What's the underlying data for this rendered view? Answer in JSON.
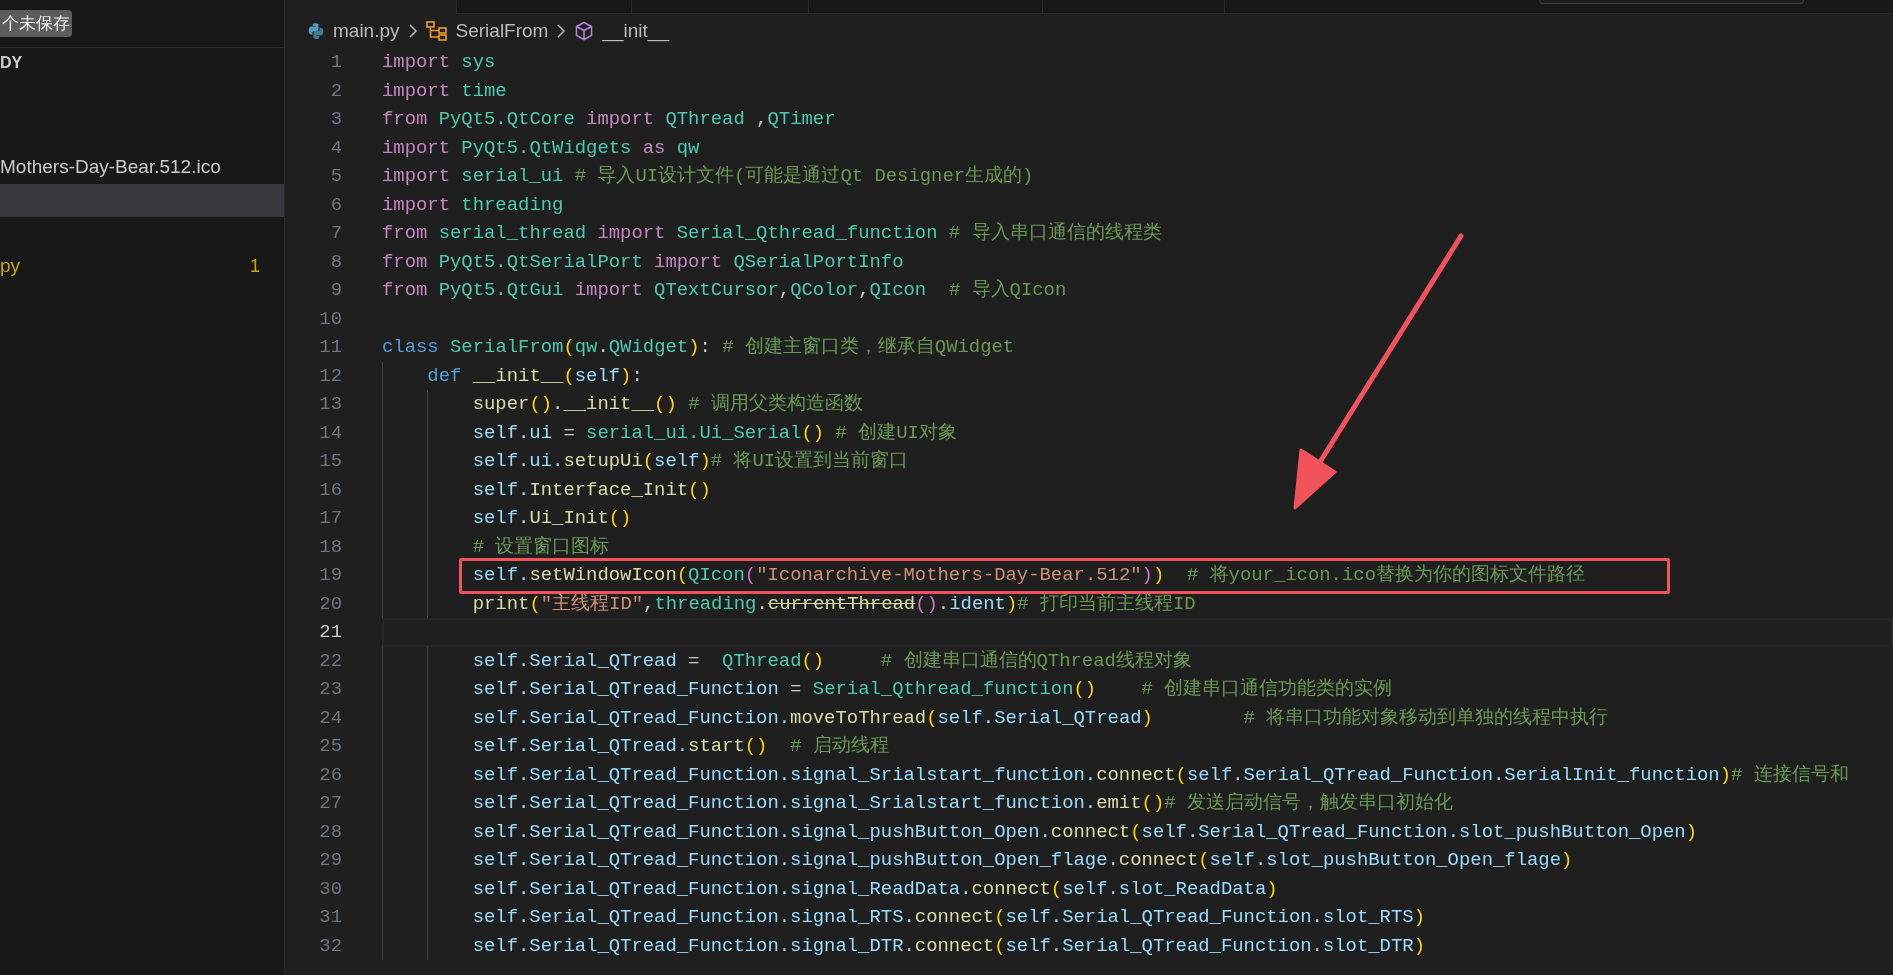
{
  "sidebar": {
    "unsaved_badge": "个未保存",
    "section_heading": "DY",
    "items": [
      {
        "name": "Mothers-Day-Bear.512.ico",
        "selected": false,
        "kind": "file"
      },
      {
        "selected": true,
        "kind": "blank"
      },
      {
        "name": "py",
        "selected": false,
        "kind": "warning",
        "problems": "1"
      }
    ]
  },
  "tabs": [
    {
      "selected": true
    },
    {
      "selected": false
    },
    {
      "selected": false
    },
    {
      "selected": false
    },
    {
      "selected": false
    }
  ],
  "breadcrumb": [
    {
      "kind": "file",
      "text": "main.py"
    },
    {
      "kind": "class",
      "text": "SerialFrom"
    },
    {
      "kind": "method",
      "text": "__init__"
    }
  ],
  "lines": [
    {
      "number": "1",
      "current": false,
      "boxed": false,
      "tokens": [
        {
          "kind": "kw",
          "text": "import "
        },
        {
          "kind": "mod",
          "text": "sys"
        }
      ]
    },
    {
      "number": "2",
      "current": false,
      "boxed": false,
      "tokens": [
        {
          "kind": "kw",
          "text": "import "
        },
        {
          "kind": "mod",
          "text": "time"
        }
      ]
    },
    {
      "number": "3",
      "current": false,
      "boxed": false,
      "tokens": [
        {
          "kind": "kw",
          "text": "from "
        },
        {
          "kind": "mod",
          "text": "PyQt5.QtCore "
        },
        {
          "kind": "kw",
          "text": "import "
        },
        {
          "kind": "mod",
          "text": "QThread"
        },
        {
          "kind": "p",
          "text": " ,"
        },
        {
          "kind": "mod",
          "text": "QTimer"
        }
      ]
    },
    {
      "number": "4",
      "current": false,
      "boxed": false,
      "tokens": [
        {
          "kind": "kw",
          "text": "import "
        },
        {
          "kind": "mod",
          "text": "PyQt5.QtWidgets "
        },
        {
          "kind": "kw",
          "text": "as "
        },
        {
          "kind": "mod",
          "text": "qw"
        }
      ]
    },
    {
      "number": "5",
      "current": false,
      "boxed": false,
      "tokens": [
        {
          "kind": "kw",
          "text": "import "
        },
        {
          "kind": "mod",
          "text": "serial_ui"
        },
        {
          "kind": "cm",
          "text": " # 导入UI设计文件(可能是通过Qt Designer生成的)"
        }
      ]
    },
    {
      "number": "6",
      "current": false,
      "boxed": false,
      "tokens": [
        {
          "kind": "kw",
          "text": "import "
        },
        {
          "kind": "mod",
          "text": "threading"
        }
      ]
    },
    {
      "number": "7",
      "current": false,
      "boxed": false,
      "tokens": [
        {
          "kind": "kw",
          "text": "from "
        },
        {
          "kind": "mod",
          "text": "serial_thread "
        },
        {
          "kind": "kw",
          "text": "import "
        },
        {
          "kind": "mod",
          "text": "Serial_Qthread_function"
        },
        {
          "kind": "cm",
          "text": " # 导入串口通信的线程类"
        }
      ]
    },
    {
      "number": "8",
      "current": false,
      "boxed": false,
      "tokens": [
        {
          "kind": "kw",
          "text": "from "
        },
        {
          "kind": "mod",
          "text": "PyQt5.QtSerialPort "
        },
        {
          "kind": "kw",
          "text": "import "
        },
        {
          "kind": "mod",
          "text": "QSerialPortInfo"
        }
      ]
    },
    {
      "number": "9",
      "current": false,
      "boxed": false,
      "tokens": [
        {
          "kind": "kw",
          "text": "from "
        },
        {
          "kind": "mod",
          "text": "PyQt5.QtGui "
        },
        {
          "kind": "kw",
          "text": "import "
        },
        {
          "kind": "mod",
          "text": "QTextCursor"
        },
        {
          "kind": "p",
          "text": ","
        },
        {
          "kind": "mod",
          "text": "QColor"
        },
        {
          "kind": "p",
          "text": ","
        },
        {
          "kind": "mod",
          "text": "QIcon"
        },
        {
          "kind": "cm",
          "text": "  # 导入QIcon"
        }
      ]
    },
    {
      "number": "10",
      "current": false,
      "boxed": false
    },
    {
      "number": "11",
      "current": false,
      "boxed": false,
      "tokens": [
        {
          "kind": "ctrl",
          "text": "class "
        },
        {
          "kind": "mod",
          "text": "SerialFrom"
        },
        {
          "kind": "b1",
          "text": "("
        },
        {
          "kind": "mod",
          "text": "qw"
        },
        {
          "kind": "p",
          "text": "."
        },
        {
          "kind": "mod",
          "text": "QWidget"
        },
        {
          "kind": "b1",
          "text": ")"
        },
        {
          "kind": "p",
          "text": ":"
        },
        {
          "kind": "cm",
          "text": " # 创建主窗口类，继承自QWidget"
        }
      ]
    },
    {
      "number": "12",
      "current": false,
      "boxed": false,
      "tokens": [
        {
          "kind": "ctrl",
          "text": "    def "
        },
        {
          "kind": "fn",
          "text": "__init__"
        },
        {
          "kind": "b1",
          "text": "("
        },
        {
          "kind": "var",
          "text": "self"
        },
        {
          "kind": "b1",
          "text": ")"
        },
        {
          "kind": "p",
          "text": ":"
        }
      ]
    },
    {
      "number": "13",
      "current": false,
      "boxed": false,
      "tokens": [
        {
          "kind": "fn",
          "text": "        super"
        },
        {
          "kind": "b1",
          "text": "()"
        },
        {
          "kind": "p",
          "text": "."
        },
        {
          "kind": "fn",
          "text": "__init__"
        },
        {
          "kind": "b1",
          "text": "()"
        },
        {
          "kind": "cm",
          "text": " # 调用父类构造函数"
        }
      ]
    },
    {
      "number": "14",
      "current": false,
      "boxed": false,
      "tokens": [
        {
          "kind": "var",
          "text": "        self.ui"
        },
        {
          "kind": "p",
          "text": " = "
        },
        {
          "kind": "mod",
          "text": "serial_ui.Ui_Serial"
        },
        {
          "kind": "b1",
          "text": "()"
        },
        {
          "kind": "cm",
          "text": " # 创建UI对象"
        }
      ]
    },
    {
      "number": "15",
      "current": false,
      "boxed": false,
      "tokens": [
        {
          "kind": "var",
          "text": "        self.ui."
        },
        {
          "kind": "fn",
          "text": "setupUi"
        },
        {
          "kind": "b1",
          "text": "("
        },
        {
          "kind": "var",
          "text": "self"
        },
        {
          "kind": "b1",
          "text": ")"
        },
        {
          "kind": "cm",
          "text": "# 将UI设置到当前窗口"
        }
      ]
    },
    {
      "number": "16",
      "current": false,
      "boxed": false,
      "tokens": [
        {
          "kind": "var",
          "text": "        self."
        },
        {
          "kind": "fn",
          "text": "Interface_Init"
        },
        {
          "kind": "b1",
          "text": "()"
        }
      ]
    },
    {
      "number": "17",
      "current": false,
      "boxed": false,
      "tokens": [
        {
          "kind": "var",
          "text": "        self."
        },
        {
          "kind": "fn",
          "text": "Ui_Init"
        },
        {
          "kind": "b1",
          "text": "()"
        }
      ]
    },
    {
      "number": "18",
      "current": false,
      "boxed": false,
      "tokens": [
        {
          "kind": "cm",
          "text": "        # 设置窗口图标"
        }
      ]
    },
    {
      "number": "19",
      "current": false,
      "boxed": true,
      "tokens": [
        {
          "kind": "var",
          "text": "        self."
        },
        {
          "kind": "fn",
          "text": "setWindowIcon"
        },
        {
          "kind": "b1",
          "text": "("
        },
        {
          "kind": "mod",
          "text": "QIcon"
        },
        {
          "kind": "b2",
          "text": "("
        },
        {
          "kind": "str",
          "text": "\"Iconarchive-Mothers-Day-Bear.512\""
        },
        {
          "kind": "b2",
          "text": ")"
        },
        {
          "kind": "b1",
          "text": ")"
        },
        {
          "kind": "cm",
          "text": "  # 将your_icon.ico替换为你的图标文件路径"
        }
      ]
    },
    {
      "number": "20",
      "current": false,
      "boxed": false,
      "tokens": [
        {
          "kind": "fn",
          "text": "        print"
        },
        {
          "kind": "b1",
          "text": "("
        },
        {
          "kind": "str",
          "text": "\"主线程ID\""
        },
        {
          "kind": "p",
          "text": ","
        },
        {
          "kind": "mod",
          "text": "threading"
        },
        {
          "kind": "p",
          "text": "."
        },
        {
          "kind": "dep",
          "text": "currentThread"
        },
        {
          "kind": "b2",
          "text": "()"
        },
        {
          "kind": "p",
          "text": "."
        },
        {
          "kind": "var",
          "text": "ident"
        },
        {
          "kind": "b1",
          "text": ")"
        },
        {
          "kind": "cm",
          "text": "# 打印当前主线程ID"
        }
      ]
    },
    {
      "number": "21",
      "current": true,
      "boxed": false
    },
    {
      "number": "22",
      "current": false,
      "boxed": false,
      "tokens": [
        {
          "kind": "var",
          "text": "        self.Serial_QTread"
        },
        {
          "kind": "p",
          "text": " =  "
        },
        {
          "kind": "mod",
          "text": "QThread"
        },
        {
          "kind": "b1",
          "text": "()"
        },
        {
          "kind": "cm",
          "text": "     # 创建串口通信的QThread线程对象"
        }
      ]
    },
    {
      "number": "23",
      "current": false,
      "boxed": false,
      "tokens": [
        {
          "kind": "var",
          "text": "        self.Serial_QTread_Function"
        },
        {
          "kind": "p",
          "text": " = "
        },
        {
          "kind": "mod",
          "text": "Serial_Qthread_function"
        },
        {
          "kind": "b1",
          "text": "()"
        },
        {
          "kind": "cm",
          "text": "    # 创建串口通信功能类的实例"
        }
      ]
    },
    {
      "number": "24",
      "current": false,
      "boxed": false,
      "tokens": [
        {
          "kind": "var",
          "text": "        self.Serial_QTread_Function."
        },
        {
          "kind": "fn",
          "text": "moveToThread"
        },
        {
          "kind": "b1",
          "text": "("
        },
        {
          "kind": "var",
          "text": "self.Serial_QTread"
        },
        {
          "kind": "b1",
          "text": ")"
        },
        {
          "kind": "cm",
          "text": "        # 将串口功能对象移动到单独的线程中执行"
        }
      ]
    },
    {
      "number": "25",
      "current": false,
      "boxed": false,
      "tokens": [
        {
          "kind": "var",
          "text": "        self.Serial_QTread."
        },
        {
          "kind": "fn",
          "text": "start"
        },
        {
          "kind": "b1",
          "text": "()"
        },
        {
          "kind": "cm",
          "text": "  # 启动线程"
        }
      ]
    },
    {
      "number": "26",
      "current": false,
      "boxed": false,
      "tokens": [
        {
          "kind": "var",
          "text": "        self.Serial_QTread_Function.signal_Srialstart_function."
        },
        {
          "kind": "fn",
          "text": "connect"
        },
        {
          "kind": "b1",
          "text": "("
        },
        {
          "kind": "var",
          "text": "self.Serial_QTread_Function.SerialInit_function"
        },
        {
          "kind": "b1",
          "text": ")"
        },
        {
          "kind": "cm",
          "text": "# 连接信号和"
        }
      ]
    },
    {
      "number": "27",
      "current": false,
      "boxed": false,
      "tokens": [
        {
          "kind": "var",
          "text": "        self.Serial_QTread_Function.signal_Srialstart_function."
        },
        {
          "kind": "fn",
          "text": "emit"
        },
        {
          "kind": "b1",
          "text": "()"
        },
        {
          "kind": "cm",
          "text": "# 发送启动信号，触发串口初始化"
        }
      ]
    },
    {
      "number": "28",
      "current": false,
      "boxed": false,
      "tokens": [
        {
          "kind": "var",
          "text": "        self.Serial_QTread_Function.signal_pushButton_Open."
        },
        {
          "kind": "fn",
          "text": "connect"
        },
        {
          "kind": "b1",
          "text": "("
        },
        {
          "kind": "var",
          "text": "self.Serial_QTread_Function.slot_pushButton_Open"
        },
        {
          "kind": "b1",
          "text": ")"
        }
      ]
    },
    {
      "number": "29",
      "current": false,
      "boxed": false,
      "tokens": [
        {
          "kind": "var",
          "text": "        self.Serial_QTread_Function.signal_pushButton_Open_flage."
        },
        {
          "kind": "fn",
          "text": "connect"
        },
        {
          "kind": "b1",
          "text": "("
        },
        {
          "kind": "var",
          "text": "self.slot_pushButton_Open_flage"
        },
        {
          "kind": "b1",
          "text": ")"
        }
      ]
    },
    {
      "number": "30",
      "current": false,
      "boxed": false,
      "tokens": [
        {
          "kind": "var",
          "text": "        self.Serial_QTread_Function.signal_ReadData."
        },
        {
          "kind": "fn",
          "text": "connect"
        },
        {
          "kind": "b1",
          "text": "("
        },
        {
          "kind": "var",
          "text": "self.slot_ReadData"
        },
        {
          "kind": "b1",
          "text": ")"
        }
      ]
    },
    {
      "number": "31",
      "current": false,
      "boxed": false,
      "tokens": [
        {
          "kind": "var",
          "text": "        self.Serial_QTread_Function.signal_RTS."
        },
        {
          "kind": "fn",
          "text": "connect"
        },
        {
          "kind": "b1",
          "text": "("
        },
        {
          "kind": "var",
          "text": "self.Serial_QTread_Function.slot_RTS"
        },
        {
          "kind": "b1",
          "text": ")"
        }
      ]
    },
    {
      "number": "32",
      "current": false,
      "boxed": false,
      "tokens": [
        {
          "kind": "var",
          "text": "        self.Serial_QTread_Function.signal_DTR."
        },
        {
          "kind": "fn",
          "text": "connect"
        },
        {
          "kind": "b1",
          "text": "("
        },
        {
          "kind": "var",
          "text": "self.Serial_QTread_Function.slot_DTR"
        },
        {
          "kind": "b1",
          "text": ")"
        }
      ]
    }
  ]
}
